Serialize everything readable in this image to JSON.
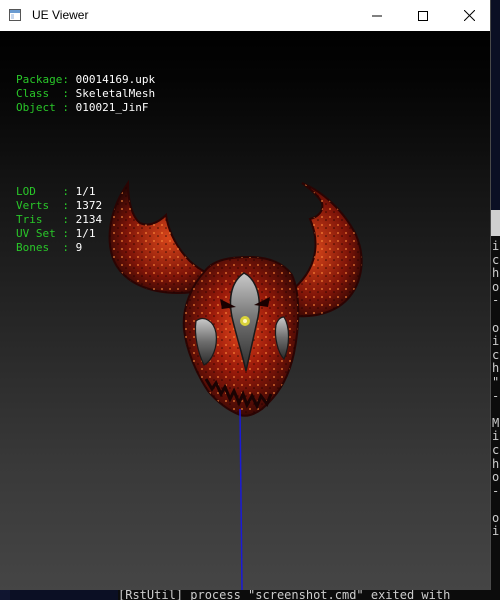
{
  "window": {
    "title": "UE Viewer"
  },
  "info": {
    "rows": [
      {
        "key": "Package",
        "value": "00014169.upk"
      },
      {
        "key": "Class  ",
        "value": "SkeletalMesh"
      },
      {
        "key": "Object ",
        "value": "010021_JinF"
      }
    ],
    "stats": [
      {
        "key": "LOD    ",
        "value": "1/1"
      },
      {
        "key": "Verts  ",
        "value": "1372"
      },
      {
        "key": "Tris   ",
        "value": "2134"
      },
      {
        "key": "UV Set ",
        "value": "1/1"
      },
      {
        "key": "Bones  ",
        "value": "9"
      }
    ],
    "separator": ": "
  },
  "background": {
    "left_char": "M",
    "console_lines": [
      "i",
      "c",
      "h",
      "o",
      "-",
      "",
      "o",
      "i",
      "c",
      "h",
      "\"",
      "-",
      "",
      "M",
      "i",
      "c",
      "h",
      "o",
      "-",
      "",
      "o",
      "i"
    ],
    "console_bottom": "[RstUtil] process \"screenshot.cmd\" exited with"
  },
  "colors": {
    "label": "#29c729",
    "value": "#ffffff",
    "bone_line": "#1a1ad6"
  }
}
